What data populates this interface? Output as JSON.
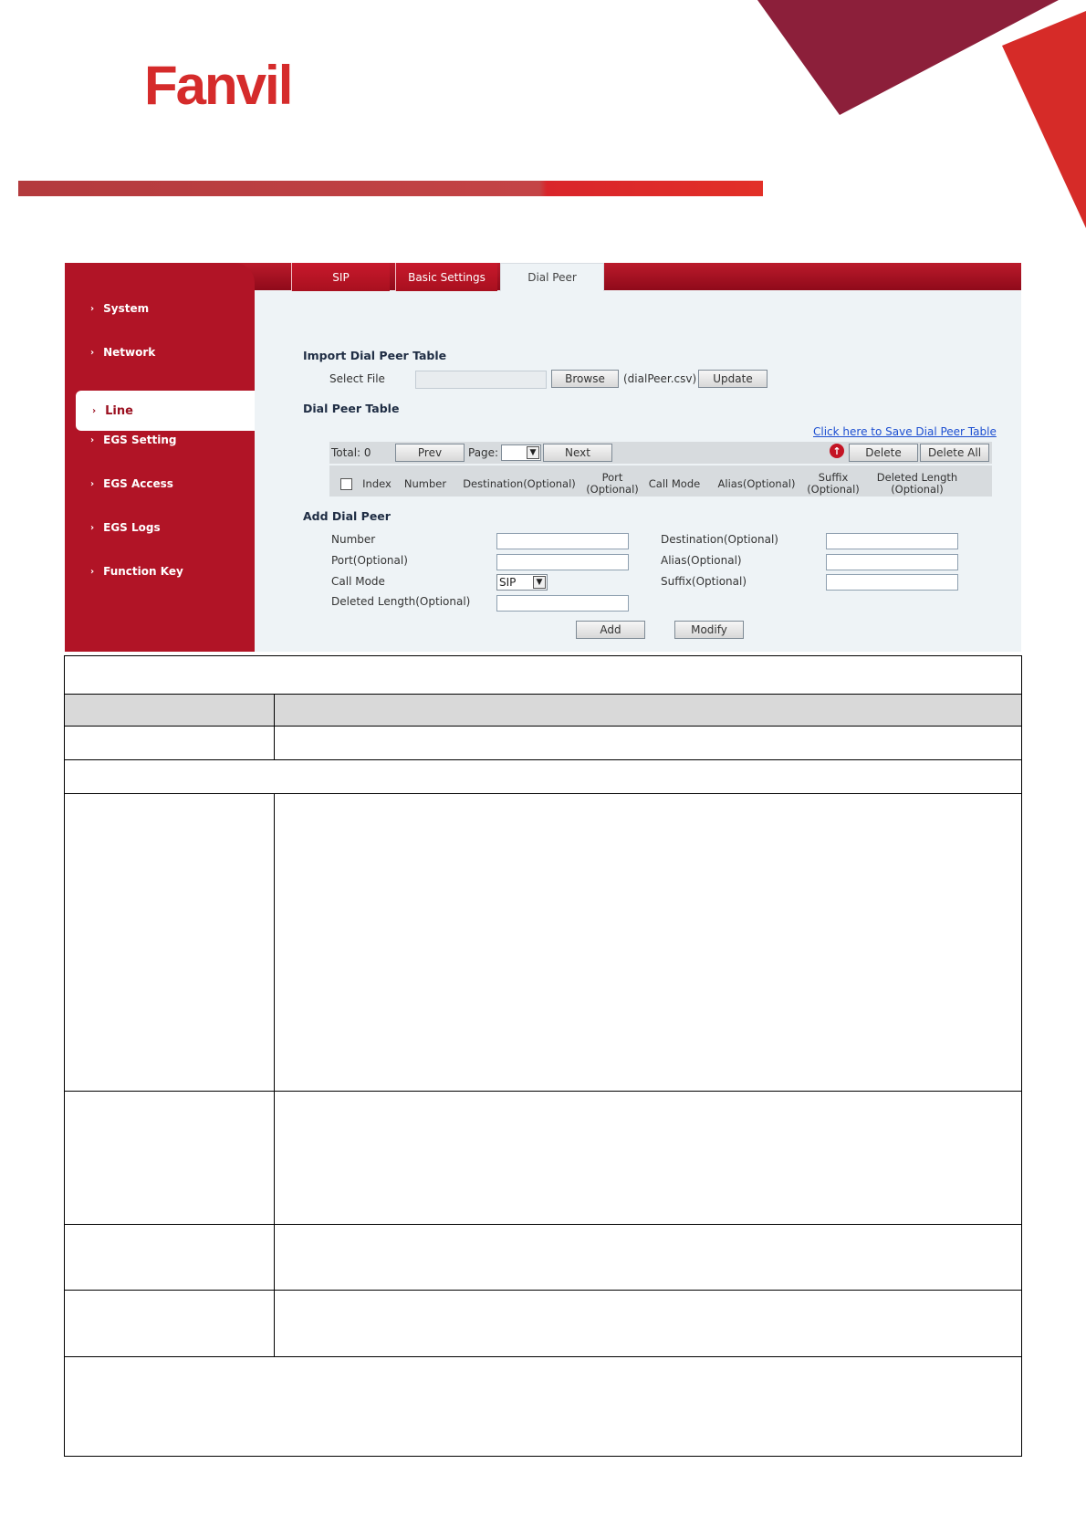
{
  "brand": {
    "logo_text": "Fanvil"
  },
  "tabs": [
    {
      "label": "SIP"
    },
    {
      "label": "Basic Settings"
    },
    {
      "label": "Dial Peer",
      "active": true
    }
  ],
  "sidebar": {
    "items": [
      {
        "label": "System"
      },
      {
        "label": "Network"
      },
      {
        "label": "Line",
        "active": true
      },
      {
        "label": "EGS Setting"
      },
      {
        "label": "EGS Access"
      },
      {
        "label": "EGS Logs"
      },
      {
        "label": "Function Key"
      }
    ]
  },
  "import": {
    "title": "Import Dial Peer Table",
    "select_file_label": "Select File",
    "browse_label": "Browse",
    "file_hint": "(dialPeer.csv)",
    "update_label": "Update"
  },
  "dial_peer_table": {
    "title": "Dial Peer Table",
    "save_link": "Click here to Save Dial Peer Table",
    "total_label": "Total: 0",
    "prev_label": "Prev",
    "page_label": "Page:",
    "next_label": "Next",
    "delete_label": "Delete",
    "delete_all_label": "Delete All",
    "columns": [
      "Index",
      "Number",
      "Destination(Optional)",
      "Port (Optional)",
      "Call Mode",
      "Alias(Optional)",
      "Suffix (Optional)",
      "Deleted Length (Optional)"
    ]
  },
  "add_dial_peer": {
    "title": "Add Dial Peer",
    "number_label": "Number",
    "destination_label": "Destination(Optional)",
    "port_label": "Port(Optional)",
    "alias_label": "Alias(Optional)",
    "call_mode_label": "Call Mode",
    "call_mode_value": "SIP",
    "suffix_label": "Suffix(Optional)",
    "deleted_length_label": "Deleted Length(Optional)",
    "add_label": "Add",
    "modify_label": "Modify"
  },
  "colors": {
    "brand_red": "#b11426",
    "panel_bg": "#eef3f6",
    "link_blue": "#1d4fd1"
  }
}
